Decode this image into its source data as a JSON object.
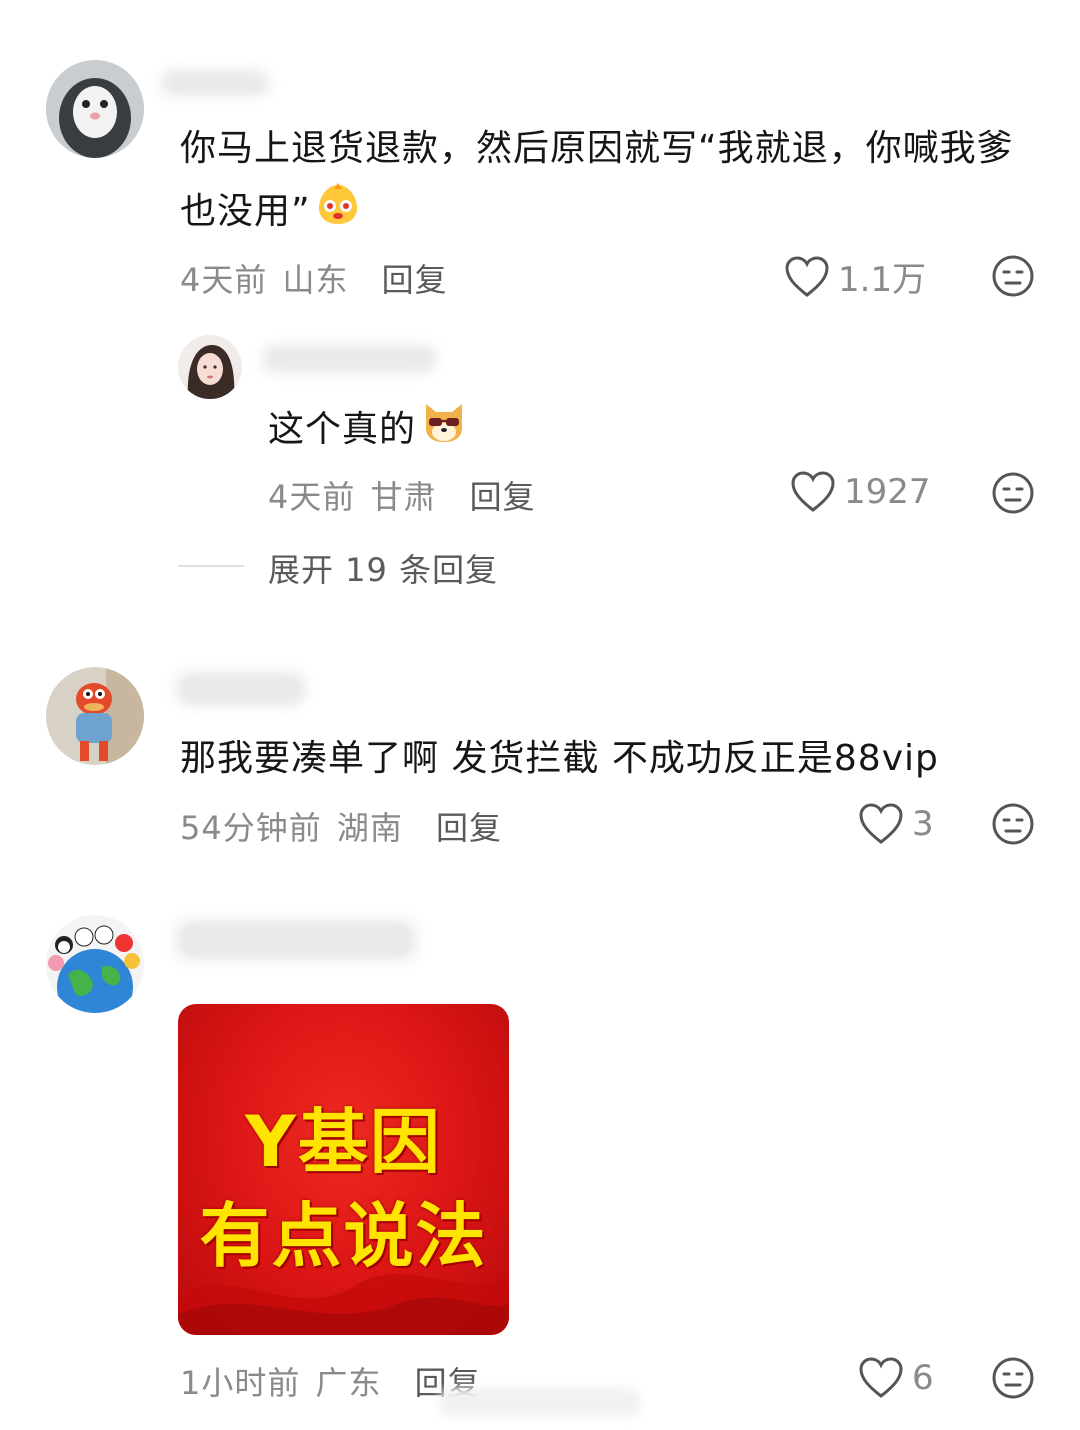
{
  "comments": [
    {
      "text": "你马上退货退款，然后原因就写“我就退，你喊我爹也没用”",
      "time": "4天前",
      "location": "山东",
      "reply_label": "回复",
      "likes": "1.1万",
      "replies": [
        {
          "text": "这个真的",
          "time": "4天前",
          "location": "甘肃",
          "reply_label": "回复",
          "likes": "1927"
        }
      ],
      "expand_label": "展开 19 条回复"
    },
    {
      "text": "那我要凑单了啊 发货拦截 不成功反正是88vip",
      "time": "54分钟前",
      "location": "湖南",
      "reply_label": "回复",
      "likes": "3"
    },
    {
      "image": {
        "line1": "Y基因",
        "line2": "有点说法"
      },
      "time": "1小时前",
      "location": "广东",
      "reply_label": "回复",
      "likes": "6"
    }
  ],
  "icons": {
    "like": "heart-outline-icon",
    "dislike": "neutral-face-icon",
    "emoji_1": "cute-blob-emoji",
    "emoji_2": "dog-sunglasses-emoji"
  },
  "colors": {
    "text": "#161616",
    "meta": "#8a8a8a",
    "action": "#5a5a5a",
    "promo_bg": "#d91414",
    "promo_text": "#ffe400"
  }
}
